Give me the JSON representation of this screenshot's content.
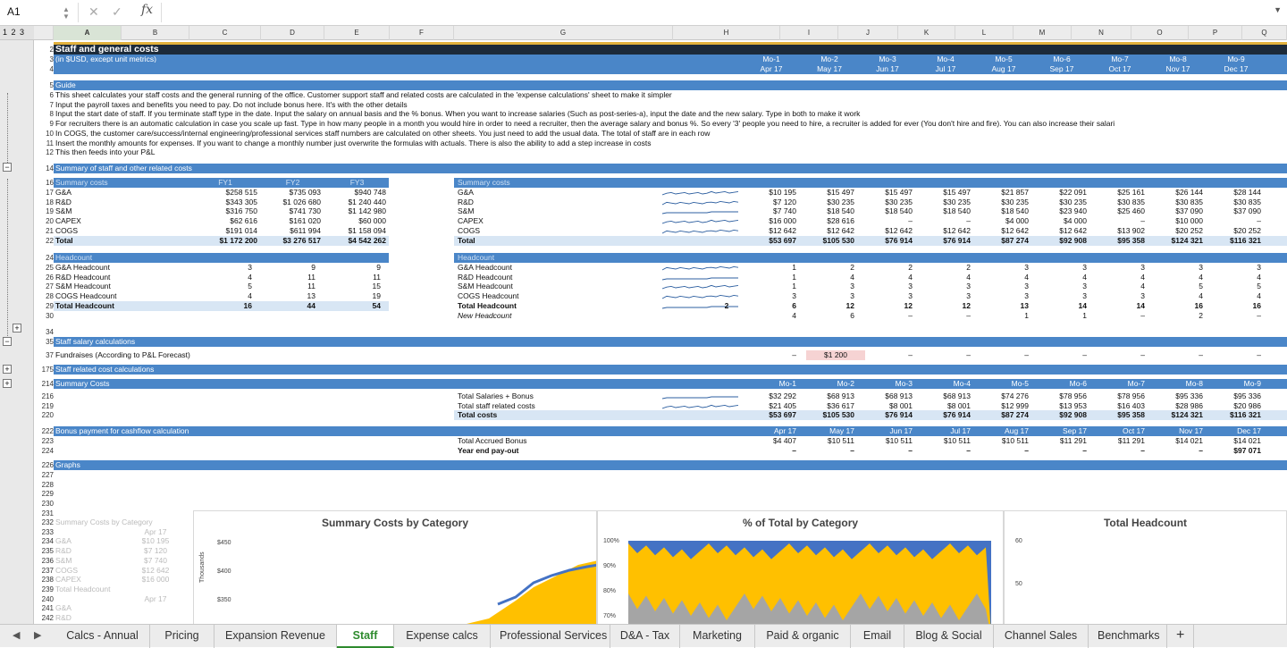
{
  "formula_bar": {
    "cell_ref": "A1",
    "formula": ""
  },
  "outline_levels": "1 2 3",
  "columns": [
    "A",
    "B",
    "C",
    "D",
    "E",
    "F",
    "G",
    "H",
    "I",
    "J",
    "K",
    "L",
    "M",
    "N",
    "O",
    "P",
    "Q"
  ],
  "title": "Staff and general costs",
  "subtitle": "(in $USD, except unit metrics)",
  "months": {
    "mo": [
      "Mo-1",
      "Mo-2",
      "Mo-3",
      "Mo-4",
      "Mo-5",
      "Mo-6",
      "Mo-7",
      "Mo-8",
      "Mo-9"
    ],
    "dates": [
      "Apr 17",
      "May 17",
      "Jun 17",
      "Jul 17",
      "Aug 17",
      "Sep 17",
      "Oct 17",
      "Nov 17",
      "Dec 17"
    ]
  },
  "guide": {
    "header": "Guide",
    "lines": [
      "This sheet calculates your staff costs and the general running of the office. Customer support staff and related costs are calculated in the 'expense calculations' sheet to make it simpler",
      "Input the payroll taxes and benefits you need to pay. Do not include bonus here. It's with the other details",
      "Input the start date of staff. If you terminate staff type in the date. Input the salary on annual basis and the % bonus. When you want to increase salaries (Such as post-series-a), input the date and the new salary. Type in both to make it work",
      "For recruiters there is an automatic calculation in case you scale up fast. Type in how many people in a month you would hire in order to need a recruiter, then the average salary and bonus %. So every '3' people you need to hire, a recruiter is added for ever (You don't hire and fire). You can also increase their salari",
      "In COGS, the customer care/success/internal engineering/professional services staff numbers are calculated on other sheets. You just need to add the usual data. The total of staff are in each row",
      "Insert the monthly amounts for expenses. If you want to change a monthly number just overwrite the formulas with actuals. There is also the ability to add a step increase in costs",
      "This then feeds into your P&L"
    ]
  },
  "summary_header": "Summary of staff and other related costs",
  "fy": {
    "header": "Summary costs",
    "cols": [
      "FY1",
      "FY2",
      "FY3"
    ],
    "rows": [
      {
        "label": "G&A",
        "v": [
          "$258 515",
          "$735 093",
          "$940 748"
        ]
      },
      {
        "label": "R&D",
        "v": [
          "$343 305",
          "$1 026 680",
          "$1 240 440"
        ]
      },
      {
        "label": "S&M",
        "v": [
          "$316 750",
          "$741 730",
          "$1 142 980"
        ]
      },
      {
        "label": "CAPEX",
        "v": [
          "$62 616",
          "$161 020",
          "$60 000"
        ]
      },
      {
        "label": "COGS",
        "v": [
          "$191 014",
          "$611 994",
          "$1 158 094"
        ]
      },
      {
        "label": "Total",
        "v": [
          "$1 172 200",
          "$3 276 517",
          "$4 542 262"
        ]
      }
    ]
  },
  "monthly_costs": {
    "header": "Summary costs",
    "rows": [
      {
        "label": "G&A",
        "v": [
          "$10 195",
          "$15 497",
          "$15 497",
          "$15 497",
          "$21 857",
          "$22 091",
          "$25 161",
          "$26 144",
          "$28 144"
        ]
      },
      {
        "label": "R&D",
        "v": [
          "$7 120",
          "$30 235",
          "$30 235",
          "$30 235",
          "$30 235",
          "$30 235",
          "$30 835",
          "$30 835",
          "$30 835"
        ]
      },
      {
        "label": "S&M",
        "v": [
          "$7 740",
          "$18 540",
          "$18 540",
          "$18 540",
          "$18 540",
          "$23 940",
          "$25 460",
          "$37 090",
          "$37 090"
        ]
      },
      {
        "label": "CAPEX",
        "v": [
          "$16 000",
          "$28 616",
          "–",
          "–",
          "$4 000",
          "$4 000",
          "–",
          "$10 000",
          "–"
        ]
      },
      {
        "label": "COGS",
        "v": [
          "$12 642",
          "$12 642",
          "$12 642",
          "$12 642",
          "$12 642",
          "$12 642",
          "$13 902",
          "$20 252",
          "$20 252"
        ]
      },
      {
        "label": "Total",
        "v": [
          "$53 697",
          "$105 530",
          "$76 914",
          "$76 914",
          "$87 274",
          "$92 908",
          "$95 358",
          "$124 321",
          "$116 321"
        ]
      }
    ]
  },
  "fy_headcount": {
    "header": "Headcount",
    "rows": [
      {
        "label": "G&A Headcount",
        "v": [
          "3",
          "9",
          "9"
        ]
      },
      {
        "label": "R&D Headcount",
        "v": [
          "4",
          "11",
          "11"
        ]
      },
      {
        "label": "S&M Headcount",
        "v": [
          "5",
          "11",
          "15"
        ]
      },
      {
        "label": "COGS Headcount",
        "v": [
          "4",
          "13",
          "19"
        ]
      },
      {
        "label": "Total Headcount",
        "v": [
          "16",
          "44",
          "54"
        ]
      }
    ]
  },
  "monthly_headcount": {
    "header": "Headcount",
    "rows": [
      {
        "label": "G&A Headcount",
        "v": [
          "1",
          "2",
          "2",
          "2",
          "3",
          "3",
          "3",
          "3",
          "3"
        ]
      },
      {
        "label": "R&D Headcount",
        "v": [
          "1",
          "4",
          "4",
          "4",
          "4",
          "4",
          "4",
          "4",
          "4"
        ]
      },
      {
        "label": "S&M Headcount",
        "v": [
          "1",
          "3",
          "3",
          "3",
          "3",
          "3",
          "4",
          "5",
          "5"
        ]
      },
      {
        "label": "COGS Headcount",
        "v": [
          "3",
          "3",
          "3",
          "3",
          "3",
          "3",
          "3",
          "4",
          "4"
        ]
      },
      {
        "label": "Total Headcount",
        "h": "2",
        "v": [
          "6",
          "12",
          "12",
          "12",
          "13",
          "14",
          "14",
          "16",
          "16"
        ]
      },
      {
        "label": "New Headcount",
        "v": [
          "4",
          "6",
          "–",
          "–",
          "1",
          "1",
          "–",
          "2",
          "–"
        ]
      }
    ]
  },
  "salary_header": "Staff salary calculations",
  "fundraises": {
    "label": "Fundraises (According to P&L Forecast)",
    "v": [
      "–",
      "$1 200",
      "–",
      "–",
      "–",
      "–",
      "–",
      "–",
      "–"
    ]
  },
  "related_header": "Staff related cost calculations",
  "summary_costs2": {
    "header": "Summary Costs",
    "rows": [
      {
        "label": "Total Salaries + Bonus",
        "v": [
          "$32 292",
          "$68 913",
          "$68 913",
          "$68 913",
          "$74 276",
          "$78 956",
          "$78 956",
          "$95 336",
          "$95 336"
        ]
      },
      {
        "label": "Total staff related costs",
        "v": [
          "$21 405",
          "$36 617",
          "$8 001",
          "$8 001",
          "$12 999",
          "$13 953",
          "$16 403",
          "$28 986",
          "$20 986"
        ]
      },
      {
        "label": "Total costs",
        "v": [
          "$53 697",
          "$105 530",
          "$76 914",
          "$76 914",
          "$87 274",
          "$92 908",
          "$95 358",
          "$124 321",
          "$116 321"
        ]
      }
    ]
  },
  "bonus": {
    "header": "Bonus payment for cashflow calculation",
    "accrued_label": "Total Accrued Bonus",
    "accrued": [
      "$4 407",
      "$10 511",
      "$10 511",
      "$10 511",
      "$10 511",
      "$11 291",
      "$11 291",
      "$14 021",
      "$14 021"
    ],
    "dates": [
      "Apr 17",
      "May 17",
      "Jun 17",
      "Jul 17",
      "Aug 17",
      "Sep 17",
      "Oct 17",
      "Nov 17",
      "Dec 17"
    ],
    "payout_label": "Year end pay-out",
    "payout": [
      "–",
      "–",
      "–",
      "–",
      "–",
      "–",
      "–",
      "–",
      "$97 071"
    ]
  },
  "graphs_header": "Graphs",
  "hidden_block": {
    "title": "Summary Costs by Category",
    "date": "Apr 17",
    "rows": [
      [
        "G&A",
        "$10 195"
      ],
      [
        "R&D",
        "$7 120"
      ],
      [
        "S&M",
        "$7 740"
      ],
      [
        "COGS",
        "$12 642"
      ],
      [
        "CAPEX",
        "$16 000"
      ]
    ],
    "hc_title": "Total Headcount",
    "hc_date": "Apr 17",
    "hc_row": "G&A",
    "hc_row2": "R&D"
  },
  "chart_data": [
    {
      "type": "area",
      "title": "Summary Costs by Category",
      "ylabel": "Thousands",
      "yticks": [
        "$450",
        "$400",
        "$350"
      ]
    },
    {
      "type": "area",
      "title": "% of Total by Category",
      "yticks": [
        "100%",
        "90%",
        "80%",
        "70%"
      ]
    },
    {
      "type": "line",
      "title": "Total Headcount",
      "yticks": [
        "60",
        "50"
      ]
    }
  ],
  "tabs": [
    "Calcs - Annual",
    "Pricing",
    "Expansion Revenue",
    "Staff",
    "Expense calcs",
    "Professional Services",
    "D&A - Tax",
    "Marketing",
    "Paid & organic",
    "Email",
    "Blog & Social",
    "Channel Sales",
    "Benchmarks"
  ],
  "active_tab": "Staff",
  "add_tab": "+",
  "colors": {
    "header_blue": "#4a86c8",
    "title_bar": "#1c2a39",
    "band": "#d8e6f4",
    "area_blue": "#4472c4",
    "area_yellow": "#ffc000",
    "area_gray": "#a5a5a5",
    "active_tab": "#2e8b2e"
  }
}
